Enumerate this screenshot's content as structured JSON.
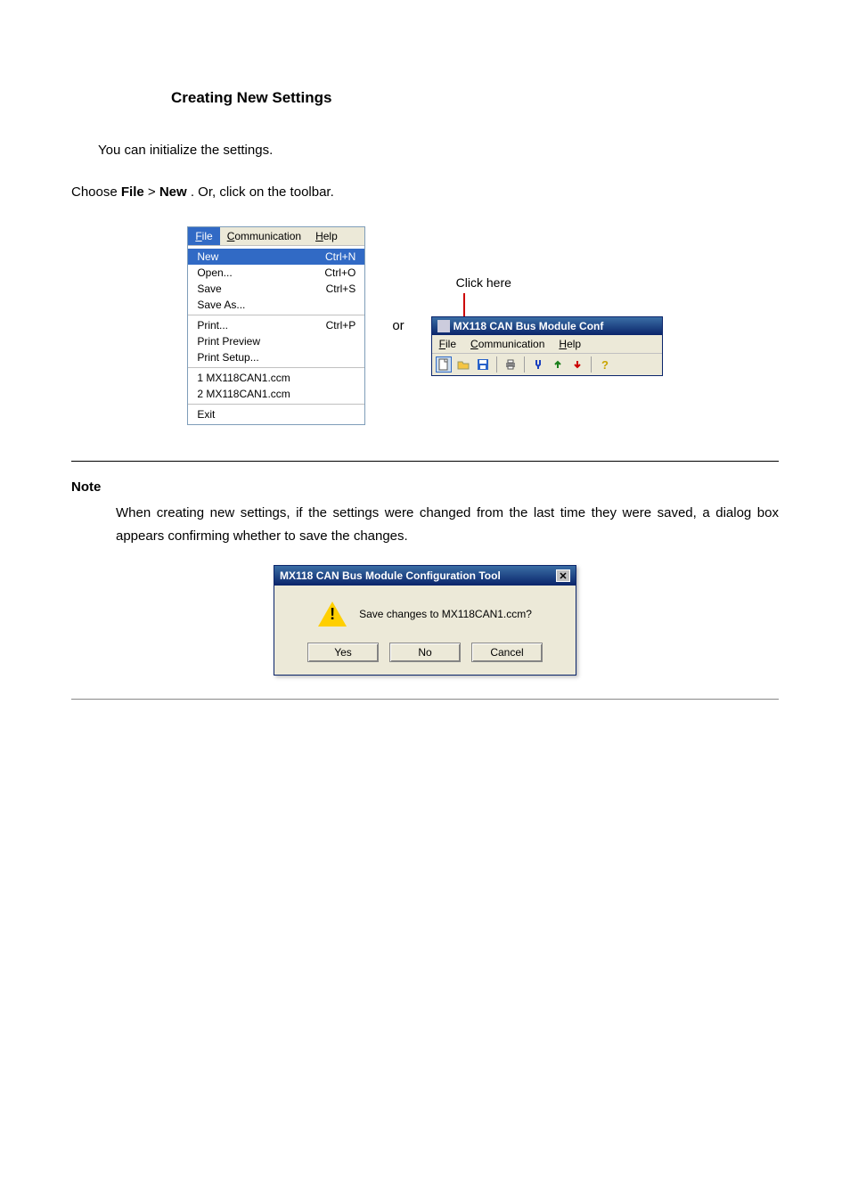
{
  "heading": "Creating New Settings",
  "intro": "You can initialize the settings.",
  "instruction_parts": {
    "p1": "Choose ",
    "b1": "File",
    "p2": " > ",
    "b2": "New",
    "p3": ". Or, click ",
    "p4": " on the toolbar."
  },
  "menu": {
    "menubar": {
      "file": "File",
      "file_u": "F",
      "comm": "Communication",
      "comm_u": "C",
      "help": "Help",
      "help_u": "H"
    },
    "items": [
      {
        "label": "New",
        "u": "N",
        "sc": "Ctrl+N",
        "sel": true
      },
      {
        "label": "Open...",
        "u": "O",
        "sc": "Ctrl+O"
      },
      {
        "label": "Save",
        "u": "S",
        "sc": "Ctrl+S"
      },
      {
        "label": "Save As...",
        "u": "A",
        "sc": ""
      }
    ],
    "items2": [
      {
        "label": "Print...",
        "u": "P",
        "sc": "Ctrl+P"
      },
      {
        "label": "Print Preview",
        "u": "v",
        "sc": ""
      },
      {
        "label": "Print Setup...",
        "u": "r",
        "sc": ""
      }
    ],
    "items3": [
      {
        "label": "1 MX118CAN1.ccm",
        "u": "1",
        "sc": ""
      },
      {
        "label": "2 MX118CAN1.ccm",
        "u": "2",
        "sc": ""
      }
    ],
    "items4": [
      {
        "label": "Exit",
        "u": "x",
        "sc": ""
      }
    ]
  },
  "or_text": "or",
  "toolbar": {
    "click_here": "Click here",
    "title": "MX118 CAN Bus Module Conf",
    "menubar": {
      "file": "File",
      "comm": "Communication",
      "help": "Help"
    },
    "icons": {
      "new": "new-icon",
      "open": "open-icon",
      "save": "save-icon",
      "print": "print-icon",
      "connect": "connect-icon",
      "upload": "upload-icon",
      "download": "download-icon",
      "about": "about-icon"
    }
  },
  "note_label": "Note",
  "note_text": "When creating new settings, if the settings were changed from the last time they were saved, a dialog box appears confirming whether to save the changes.",
  "dialog": {
    "title": "MX118 CAN Bus Module Configuration Tool",
    "message": "Save changes to MX118CAN1.ccm?",
    "yes": "Yes",
    "no": "No",
    "cancel": "Cancel"
  }
}
